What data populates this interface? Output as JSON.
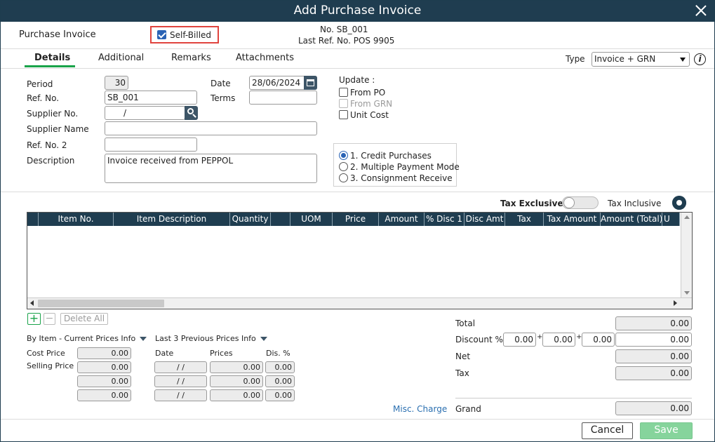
{
  "window": {
    "title": "Add Purchase Invoice"
  },
  "header": {
    "doc_type_label": "Purchase Invoice",
    "self_billed_label": "Self-Billed",
    "self_billed_checked": true,
    "doc_no": "No. SB_001",
    "last_ref": "Last Ref. No. POS 9905"
  },
  "tabs": [
    {
      "label": "Details",
      "active": true
    },
    {
      "label": "Additional"
    },
    {
      "label": "Remarks"
    },
    {
      "label": "Attachments"
    }
  ],
  "type_select": {
    "label": "Type",
    "value": "Invoice + GRN"
  },
  "form": {
    "period_label": "Period",
    "period_value": "30",
    "date_label": "Date",
    "date_value": "28/06/2024",
    "refno_label": "Ref. No.",
    "refno_value": "SB_001",
    "terms_label": "Terms",
    "terms_value": "",
    "supplier_no_label": "Supplier No.",
    "supplier_no_value": "/",
    "supplier_name_label": "Supplier Name",
    "supplier_name_value": "",
    "refno2_label": "Ref. No. 2",
    "refno2_value": "",
    "description_label": "Description",
    "description_value": "Invoice received from PEPPOL"
  },
  "update": {
    "label": "Update :",
    "options": [
      {
        "label": "From PO",
        "checked": false,
        "disabled": false
      },
      {
        "label": "From GRN",
        "checked": false,
        "disabled": true
      },
      {
        "label": "Unit Cost",
        "checked": false,
        "disabled": false
      }
    ]
  },
  "payment_mode": {
    "options": [
      {
        "label": "1. Credit Purchases",
        "selected": true
      },
      {
        "label": "2. Multiple Payment Mode",
        "selected": false
      },
      {
        "label": "3. Consignment Receive",
        "selected": false
      }
    ]
  },
  "tax_toggle": {
    "left_label": "Tax Exclusive",
    "right_label": "Tax Inclusive",
    "on": false
  },
  "grid": {
    "columns": [
      "",
      "Item No.",
      "Item Description",
      "Quantity",
      "",
      "UOM",
      "Price",
      "Amount",
      "% Disc 1",
      "Disc Amt",
      "Tax",
      "Tax Amount",
      "Amount (Total)",
      "U"
    ],
    "rows": []
  },
  "grid_buttons": {
    "add": "+",
    "remove": "−",
    "delete_all": "Delete All"
  },
  "price_info": {
    "by_item_label": "By Item - Current Prices Info",
    "cost_price_label": "Cost Price",
    "selling_price_label": "Selling Price",
    "current_values": [
      "0.00",
      "0.00",
      "0.00",
      "0.00"
    ],
    "last3_label": "Last 3 Previous Prices Info",
    "date_header": "Date",
    "prices_header": "Prices",
    "dis_header": "Dis. %",
    "rows": [
      {
        "date": "/   /",
        "price": "0.00",
        "dis": "0.00"
      },
      {
        "date": "/   /",
        "price": "0.00",
        "dis": "0.00"
      },
      {
        "date": "/   /",
        "price": "0.00",
        "dis": "0.00"
      }
    ]
  },
  "totals": {
    "total_label": "Total",
    "total_value": "0.00",
    "discount_label": "Discount %",
    "disc1": "0.00",
    "disc2": "0.00",
    "disc3": "0.00",
    "discount_value": "0.00",
    "plus": "+",
    "net_label": "Net",
    "net_value": "0.00",
    "tax_label": "Tax",
    "tax_value": "0.00",
    "misc_charge_label": "Misc. Charge",
    "grand_label": "Grand",
    "grand_value": "0.00"
  },
  "footer": {
    "cancel_label": "Cancel",
    "save_label": "Save"
  },
  "colors": {
    "titlebar": "#1f3d50",
    "accent": "#2a63b5",
    "highlight_border": "#e0443e",
    "save_button": "#86d49c",
    "tab_underline": "#1aa34a"
  }
}
